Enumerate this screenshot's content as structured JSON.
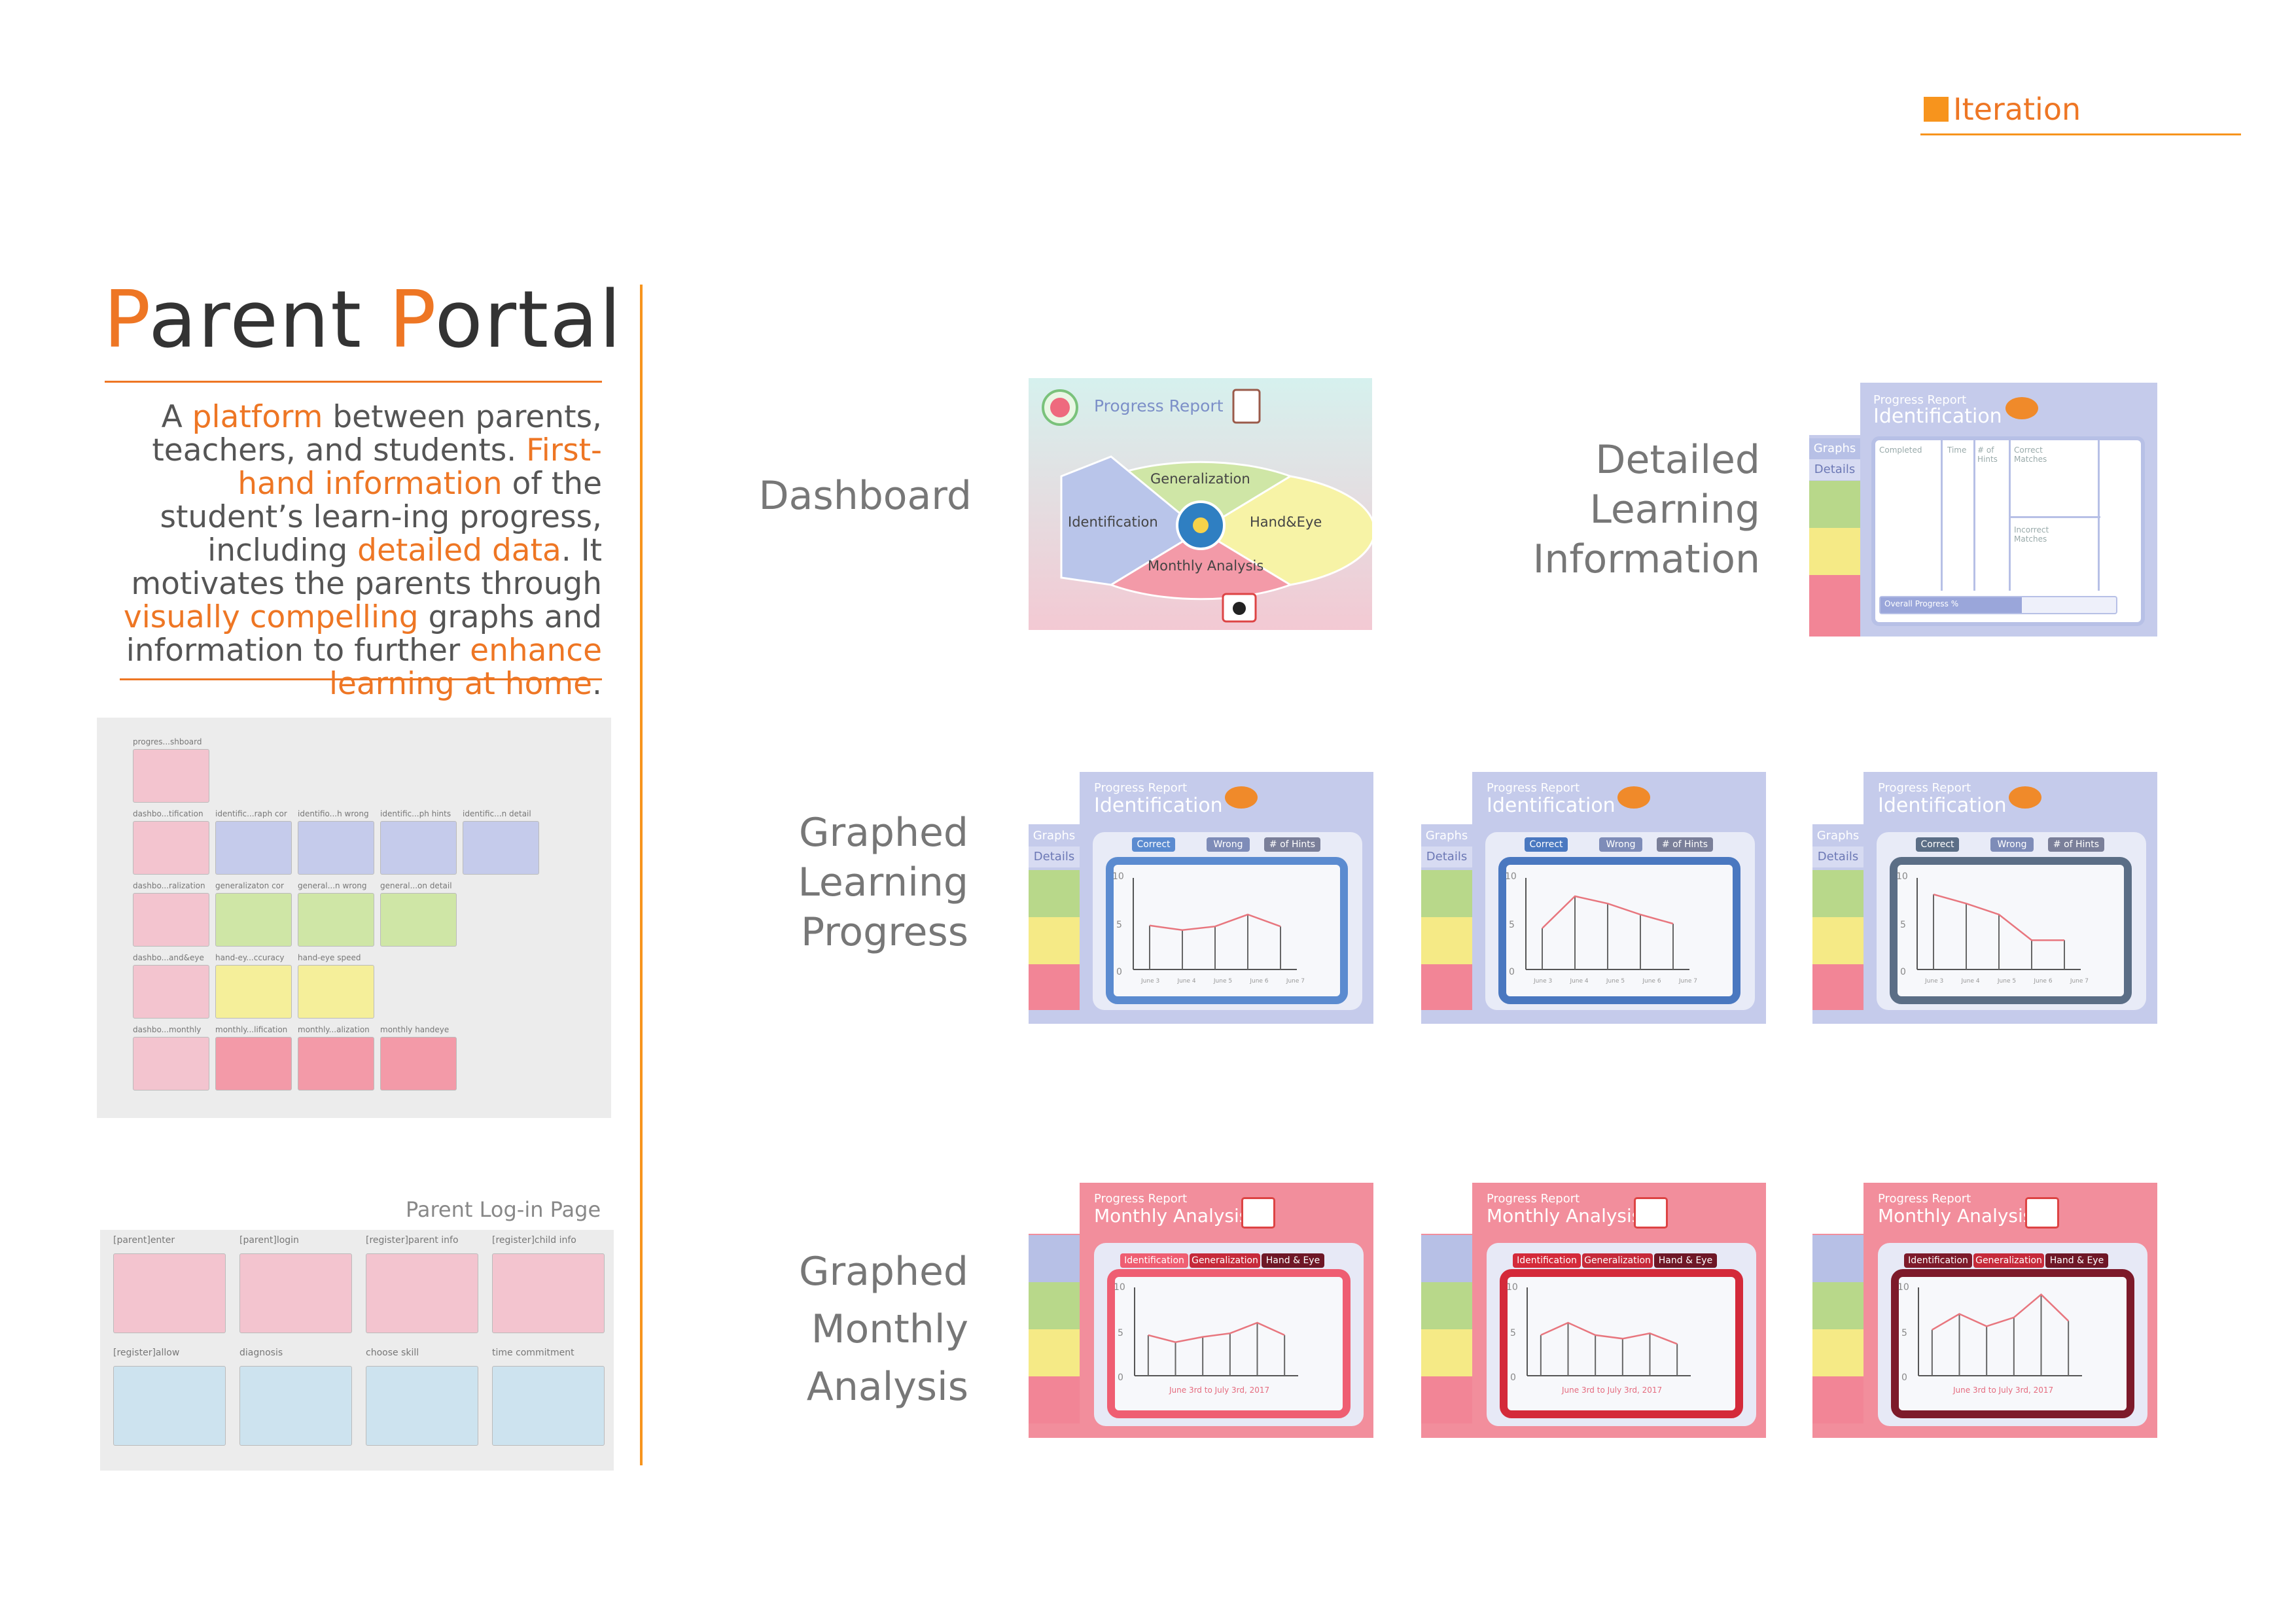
{
  "header": {
    "section_label": "Iteration"
  },
  "title": {
    "part1_cap": "P",
    "part1_rest": "arent ",
    "part2_cap": "P",
    "part2_rest": "ortal"
  },
  "description": {
    "s1": "A ",
    "h1": "platform",
    "s2": " between parents, teachers, and students. ",
    "h2": "First-hand information",
    "s3": " of the student’s learn-ing progress, including ",
    "h3": "detailed data",
    "s4": ". It motivates the parents through ",
    "h4": "visually compelling",
    "s5": " graphs and information to further ",
    "h5": "enhance learning at home",
    "s6": "."
  },
  "sitemap": {
    "labels": [
      "progres...shboard",
      "dashbo...tification",
      "identific...raph cor",
      "identifio...h wrong",
      "identific...ph hints",
      "identific...n detail",
      "dashbo...ralization",
      "generalizaton cor",
      "general...n wrong",
      "general...on detail",
      "dashbo...and&eye",
      "hand-ey...ccuracy",
      "hand-eye speed",
      "dashbo...monthly",
      "monthly...lification",
      "monthly...alization",
      "monthly handeye"
    ]
  },
  "login": {
    "caption": "Parent Log-in Page",
    "labels": [
      "[parent]enter",
      "[parent]login",
      "[register]parent info",
      "[register]child info",
      "[register]allow",
      "diagnosis",
      "choose skill",
      "time commitment"
    ]
  },
  "sections": {
    "dashboard": "Dashboard",
    "detailed": [
      "Detailed",
      "Learning",
      "Information"
    ],
    "graphed_progress": [
      "Graphed",
      "Learning",
      "Progress"
    ],
    "graphed_monthly": [
      "Graphed",
      "Monthly",
      "Analysis"
    ]
  },
  "dashboard_screen": {
    "title": "Progress Report",
    "segments": [
      "Generalization",
      "Identification",
      "Hand&Eye",
      "Monthly Analysis"
    ]
  },
  "detail_screen": {
    "sub": "Progress Report",
    "title": "Identification",
    "tabs": [
      "Graphs",
      "Details"
    ],
    "columns": [
      "Completed",
      "Time",
      "# of Hints",
      "Correct Matches",
      "Incorrect Matches"
    ],
    "progress_label": "Overall Progress %",
    "progress": 0.6
  },
  "progress_screens": {
    "sub": "Progress Report",
    "title": "Identification",
    "side_tabs": [
      "Graphs",
      "Details"
    ],
    "tabs": [
      "Correct",
      "Wrong",
      "# of Hints"
    ],
    "y_ticks": [
      "10",
      "5",
      "0"
    ],
    "x_ticks": [
      "June 3",
      "June 4",
      "June 5",
      "June 6",
      "June 7"
    ],
    "frame_colors": [
      "#5b8bd0",
      "#4a78c0",
      "#5b6e86"
    ],
    "values": [
      [
        4.8,
        4.3,
        4.7,
        6.0,
        4.7
      ],
      [
        4.5,
        8.0,
        7.2,
        6.0,
        5.0
      ],
      [
        8.2,
        7.2,
        6.0,
        3.2,
        3.2
      ]
    ]
  },
  "monthly_screens": {
    "sub": "Progress Report",
    "title": "Monthly Analysis",
    "tabs": [
      "Identification",
      "Generalization",
      "Hand & Eye"
    ],
    "y_ticks": [
      "10",
      "5",
      "0"
    ],
    "x_caption": "June 3rd to July 3rd, 2017",
    "frame_colors": [
      "#ef5e72",
      "#d42a3a",
      "#7d1a2a"
    ],
    "values": [
      [
        4.6,
        3.8,
        4.4,
        4.8,
        6.0,
        4.6
      ],
      [
        4.6,
        6.0,
        4.6,
        4.2,
        4.8,
        3.6
      ],
      [
        5.2,
        7.0,
        5.6,
        6.6,
        9.2,
        6.2
      ]
    ]
  }
}
